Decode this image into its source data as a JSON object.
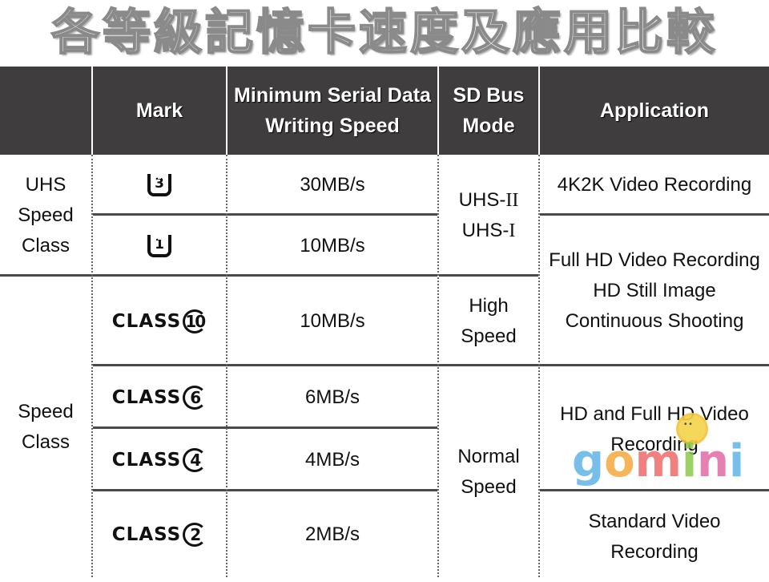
{
  "title": "各等級記憶卡速度及應用比較",
  "headers": {
    "category": "",
    "mark": "Mark",
    "speed": "Minimum Serial Data\nWriting Speed",
    "bus": "SD Bus\nMode",
    "application": "Application"
  },
  "categories": {
    "uhs": "UHS\nSpeed\nClass",
    "speed": "Speed\nClass"
  },
  "rows": [
    {
      "mark_type": "uhs",
      "mark_value": "3",
      "mark_name": "uhs-speed-class-3-icon",
      "speed": "30MB/s"
    },
    {
      "mark_type": "uhs",
      "mark_value": "1",
      "mark_name": "uhs-speed-class-1-icon",
      "speed": "10MB/s"
    },
    {
      "mark_type": "class",
      "mark_label": "CLASS",
      "mark_value": "10",
      "mark_name": "class-10-icon",
      "speed": "10MB/s"
    },
    {
      "mark_type": "class",
      "mark_label": "CLASS",
      "mark_value": "6",
      "mark_name": "class-6-icon",
      "speed": "6MB/s"
    },
    {
      "mark_type": "class",
      "mark_label": "CLASS",
      "mark_value": "4",
      "mark_name": "class-4-icon",
      "speed": "4MB/s"
    },
    {
      "mark_type": "class",
      "mark_label": "CLASS",
      "mark_value": "2",
      "mark_name": "class-2-icon",
      "speed": "2MB/s"
    }
  ],
  "bus_modes": {
    "uhs_line1_prefix": "UHS-",
    "uhs_line1_roman": "II",
    "uhs_line2_prefix": "UHS-",
    "uhs_line2_roman": "I",
    "high": "High\nSpeed",
    "normal": "Normal\nSpeed"
  },
  "applications": {
    "uhs3": "4K2K Video Recording",
    "fullhd": "Full HD Video Recording\nHD Still Image\nContinuous Shooting",
    "hd": "HD and Full HD Video\nRecording",
    "standard": "Standard Video\nRecording"
  },
  "watermark": {
    "letters": [
      "g",
      "o",
      "m",
      "i",
      "n",
      "i"
    ],
    "colors": [
      "#5fb4e8",
      "#f4a93b",
      "#ef6b6b",
      "#8cc84b",
      "#e26aa6",
      "#5fb4e8"
    ]
  }
}
